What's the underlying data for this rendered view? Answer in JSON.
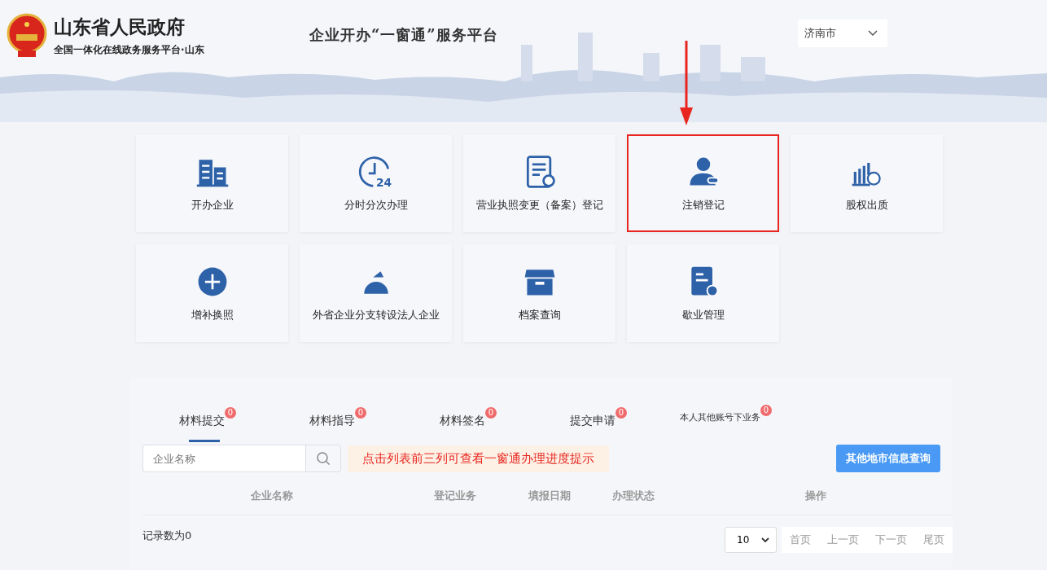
{
  "header": {
    "title": "山东省人民政府",
    "subtitle": "全国一体化在线政务服务平台·山东",
    "platform": "企业开办“一窗通”服务平台",
    "city": "济南市"
  },
  "annotation": {
    "arrow": true
  },
  "tiles": [
    {
      "label": "开办企业",
      "kind": "building",
      "highlighted": false
    },
    {
      "label": "分时分次办理",
      "kind": "clock",
      "icon_text": "24",
      "highlighted": false
    },
    {
      "label": "营业执照变更（备案）登记",
      "kind": "document",
      "highlighted": false
    },
    {
      "label": "注销登记",
      "kind": "person",
      "highlighted": true
    },
    {
      "label": "股权出质",
      "kind": "bars",
      "highlighted": false
    },
    {
      "label": "增补换照",
      "kind": "plus",
      "highlighted": false
    },
    {
      "label": "外省企业分支转设法人企业",
      "kind": "dome",
      "highlighted": false
    },
    {
      "label": "档案查询",
      "kind": "archive",
      "highlighted": false
    },
    {
      "label": "歇业管理",
      "kind": "docgear",
      "highlighted": false
    }
  ],
  "tabs": [
    {
      "label": "材料提交",
      "count": "0",
      "selected": true
    },
    {
      "label": "材料指导",
      "count": "0",
      "selected": false
    },
    {
      "label": "材料签名",
      "count": "0",
      "selected": false
    },
    {
      "label": "提交申请",
      "count": "0",
      "selected": false
    },
    {
      "label": "本人其他账号下业务",
      "count": "0",
      "selected": false
    }
  ],
  "search": {
    "placeholder": "企业名称"
  },
  "notice": "点击列表前三列可查看一窗通办理进度提示",
  "other_city_button": "其他地市信息查询",
  "table": {
    "columns": [
      "企业名称",
      "登记业务",
      "填报日期",
      "办理状态",
      "操作"
    ]
  },
  "record_count": "记录数为0",
  "pagination": {
    "page_size": "10",
    "buttons": [
      "首页",
      "上一页",
      "下一页",
      "尾页"
    ]
  }
}
